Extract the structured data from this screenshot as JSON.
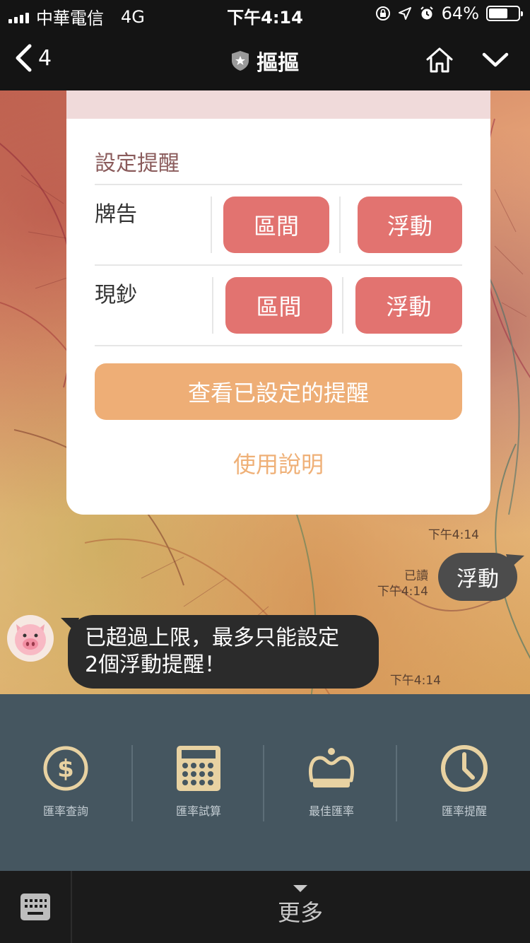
{
  "status_bar": {
    "carrier": "中華電信",
    "network": "4G",
    "time": "下午4:14",
    "battery": "64%",
    "battery_level": 0.64
  },
  "nav": {
    "back_count": "4",
    "title": "摳摳"
  },
  "card": {
    "section_title": "設定提醒",
    "rows": [
      {
        "label": "牌告",
        "btn_range": "區間",
        "btn_float": "浮動"
      },
      {
        "label": "現鈔",
        "btn_range": "區間",
        "btn_float": "浮動"
      }
    ],
    "view_button": "查看已設定的提醒",
    "help_link": "使用說明"
  },
  "messages": {
    "card_time": "下午4:14",
    "sent": {
      "text": "浮動",
      "read": "已讀",
      "time": "下午4:14"
    },
    "received": {
      "line1": "已超過上限，最多只能設定",
      "line2": "2個浮動提醒！",
      "time": "下午4:14"
    }
  },
  "menu": {
    "items": [
      {
        "label": "匯率查詢",
        "icon": "dollar-coin-icon"
      },
      {
        "label": "匯率試算",
        "icon": "calculator-icon"
      },
      {
        "label": "最佳匯率",
        "icon": "crown-icon"
      },
      {
        "label": "匯率提醒",
        "icon": "clock-icon"
      }
    ]
  },
  "bottom": {
    "more_label": "更多"
  },
  "colors": {
    "accent_red": "#e27370",
    "accent_orange": "#eeae76",
    "menu_bg": "#455660",
    "menu_icon": "#e8d2a2"
  }
}
